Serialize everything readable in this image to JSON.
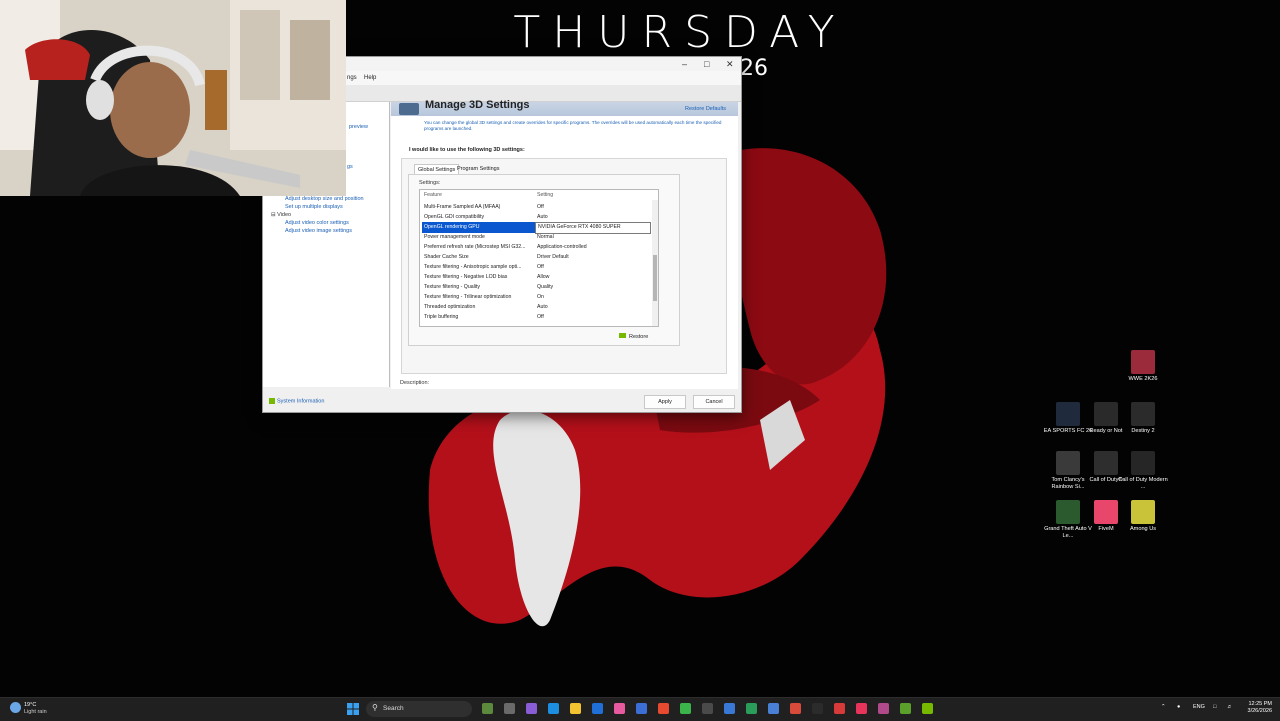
{
  "desktop_widget": {
    "day": "THURSDAY",
    "date": "26"
  },
  "window": {
    "menu": {
      "fragment": "ngs",
      "help": "Help"
    },
    "left_pane": {
      "preview": "preview",
      "frag1": "gs",
      "display_items": [
        "Adjust desktop size and position",
        "Set up multiple displays"
      ],
      "video_category": "Video",
      "video_items": [
        "Adjust video color settings",
        "Adjust video image settings"
      ]
    },
    "page_title": "Manage 3D Settings",
    "restore_defaults": "Restore Defaults",
    "intro": "You can change the global 3D settings and create overrides for specific programs. The overrides will be used automatically each time the specified programs are launched.",
    "lead": "I would like to use the following 3D settings:",
    "tabs": [
      "Global Settings",
      "Program Settings"
    ],
    "settings_label": "Settings:",
    "grid_headers": {
      "feature": "Feature",
      "setting": "Setting"
    },
    "rows": [
      {
        "feature": "Multi-Frame Sampled AA (MFAA)",
        "setting": "Off"
      },
      {
        "feature": "OpenGL GDI compatibility",
        "setting": "Auto"
      },
      {
        "feature": "OpenGL rendering GPU",
        "setting": "NVIDIA GeForce RTX 4080 SUPER",
        "selected": true
      },
      {
        "feature": "Power management mode",
        "setting": "Normal"
      },
      {
        "feature": "Preferred refresh rate (Microstep MSI G32...",
        "setting": "Application-controlled"
      },
      {
        "feature": "Shader Cache Size",
        "setting": "Driver Default"
      },
      {
        "feature": "Texture filtering - Anisotropic sample opti...",
        "setting": "Off"
      },
      {
        "feature": "Texture filtering - Negative LOD bias",
        "setting": "Allow"
      },
      {
        "feature": "Texture filtering - Quality",
        "setting": "Quality"
      },
      {
        "feature": "Texture filtering - Trilinear optimization",
        "setting": "On"
      },
      {
        "feature": "Threaded optimization",
        "setting": "Auto"
      },
      {
        "feature": "Triple buffering",
        "setting": "Off"
      }
    ],
    "restore": "Restore",
    "description_label": "Description:",
    "system_information": "System Information",
    "apply": "Apply",
    "cancel": "Cancel"
  },
  "desktop_icons": [
    {
      "label": "WWE 2K26",
      "color": "#9b2a3a"
    },
    {
      "label": "EA SPORTS FC 26",
      "color": "#1f2b3d"
    },
    {
      "label": "Ready or Not",
      "color": "#2a2a2a"
    },
    {
      "label": "Destiny 2",
      "color": "#2b2b2b"
    },
    {
      "label": "Tom Clancy's Rainbow Si...",
      "color": "#3a3a3a"
    },
    {
      "label": "Call of Duty®",
      "color": "#2e2e2e"
    },
    {
      "label": "Call of Duty Modern ...",
      "color": "#262626"
    },
    {
      "label": "Grand Theft Auto V Le...",
      "color": "#2b5a2f"
    },
    {
      "label": "FiveM",
      "color": "#e8476b"
    },
    {
      "label": "Among Us",
      "color": "#c9c33a"
    }
  ],
  "taskbar": {
    "weather_temp": "19°C",
    "weather_cond": "Light rain",
    "search": "Search",
    "lang": "ENG",
    "time": "12:25 PM",
    "date": "3/26/2026"
  }
}
